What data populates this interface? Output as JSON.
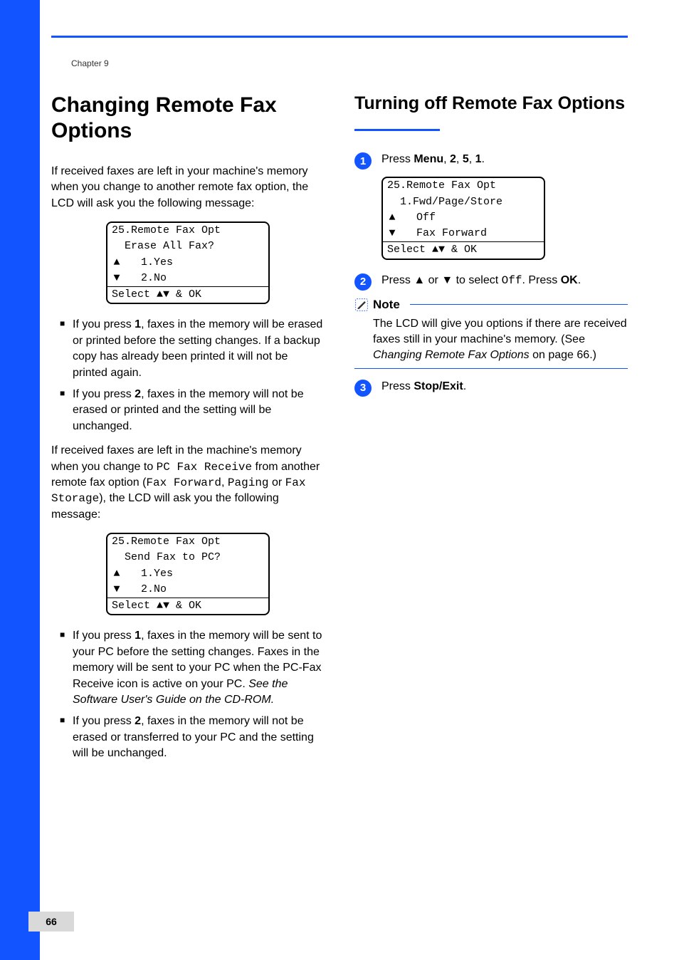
{
  "chapter_label": "Chapter 9",
  "page_number": "66",
  "left": {
    "heading": "Changing Remote Fax Options",
    "intro": "If received faxes are left in your machine's memory when you change to another remote fax option, the LCD will ask you the following message:",
    "lcd1": {
      "l1": "25.Remote Fax Opt",
      "l2": "  Erase All Fax?",
      "l3opt": "1.Yes",
      "l4opt": "2.No",
      "select": "Select ab & OK"
    },
    "bullet1a_pre": "If you press ",
    "bullet1a_key": "1",
    "bullet1a_post": ", faxes in the memory will be erased or printed before the setting changes. If a backup copy has already been printed it will not be printed again.",
    "bullet1b_pre": "If you press ",
    "bullet1b_key": "2",
    "bullet1b_post": ", faxes in the memory will not be erased or printed and the setting will be unchanged.",
    "mid_p1": "If received faxes are left in the machine's memory when you change to ",
    "mid_code1": "PC Fax Receive",
    "mid_p2": " from another remote fax option (",
    "mid_code2": "Fax Forward",
    "mid_p3": ", ",
    "mid_code3": "Paging",
    "mid_p4": " or ",
    "mid_code4": "Fax Storage",
    "mid_p5": "), the LCD will ask you the following message:",
    "lcd2": {
      "l1": "25.Remote Fax Opt",
      "l2": "  Send Fax to PC?",
      "l3opt": "1.Yes",
      "l4opt": "2.No",
      "select": "Select ab & OK"
    },
    "bullet2a_pre": "If you press ",
    "bullet2a_key": "1",
    "bullet2a_post": ", faxes in the memory will be sent to your PC before the setting changes. Faxes in the memory will be sent to your PC when the PC-Fax Receive icon is active on your PC. ",
    "bullet2a_italic": "See the Software User's Guide on the CD-ROM.",
    "bullet2b_pre": "If you press ",
    "bullet2b_key": "2",
    "bullet2b_post": ", faxes in the memory will not be erased or transferred to your PC and the setting will be unchanged."
  },
  "right": {
    "heading": "Turning off Remote Fax Options",
    "heading_tail_index": "9",
    "step1_pre": "Press ",
    "step1_menu": "Menu",
    "step1_c1": ", ",
    "step1_k2": "2",
    "step1_c2": ", ",
    "step1_k5": "5",
    "step1_c3": ", ",
    "step1_k1": "1",
    "step1_end": ".",
    "lcd3": {
      "l1": "25.Remote Fax Opt",
      "l2": "  1.Fwd/Page/Store",
      "l3opt": "Off",
      "l4opt": "Fax Forward",
      "select": "Select ab & OK"
    },
    "step2_pre": "Press ",
    "step2_mid": " or ",
    "step2_tosel": " to select ",
    "step2_code": "Off",
    "step2_press": ". Press ",
    "step2_ok": "OK",
    "step2_end": ".",
    "note_label": "Note",
    "note_body_pre": "The LCD will give you options if there are received faxes still in your machine's memory. (See ",
    "note_body_ital": "Changing Remote Fax Options",
    "note_body_post": " on page 66.)",
    "step3_pre": "Press ",
    "step3_b": "Stop/Exit",
    "step3_end": "."
  },
  "glyphs": {
    "up": "▲",
    "down": "▼"
  },
  "stepnums": {
    "s1": "1",
    "s2": "2",
    "s3": "3"
  }
}
